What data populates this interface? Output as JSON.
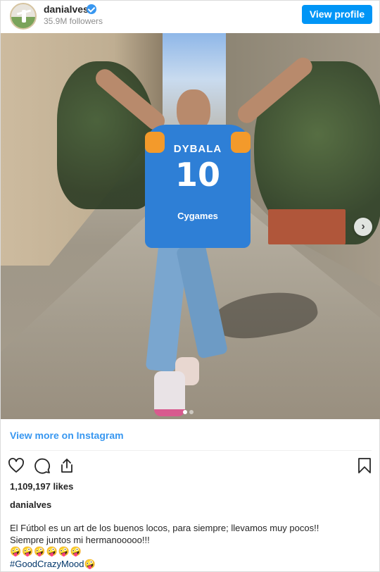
{
  "header": {
    "username": "danialves",
    "followers": "35.9M followers",
    "view_profile_label": "View profile"
  },
  "photo": {
    "jersey_name": "DYBALA",
    "jersey_number": "10",
    "jersey_sponsor": "Cygames",
    "carousel_next_label": "›",
    "carousel_position": 1,
    "carousel_total": 2
  },
  "footer": {
    "view_more_label": "View more on Instagram",
    "likes": "1,109,197 likes",
    "caption_username": "danialves",
    "caption_line1": "El Fútbol es un art de los buenos locos, para siempre; llevamos muy pocos!!",
    "caption_line2": "Siempre juntos mi hermanooooo!!!",
    "caption_emojis": "🤪🤪🤪🤪🤪🤪",
    "caption_hashtag": "#GoodCrazyMood🤪"
  },
  "colors": {
    "accent": "#0095f6",
    "link": "#3897f0",
    "hashtag": "#003569",
    "text": "#262626",
    "muted": "#8e8e8e"
  },
  "icons": [
    "verified-icon",
    "heart-icon",
    "comment-icon",
    "share-icon",
    "bookmark-icon",
    "chevron-right-icon"
  ]
}
